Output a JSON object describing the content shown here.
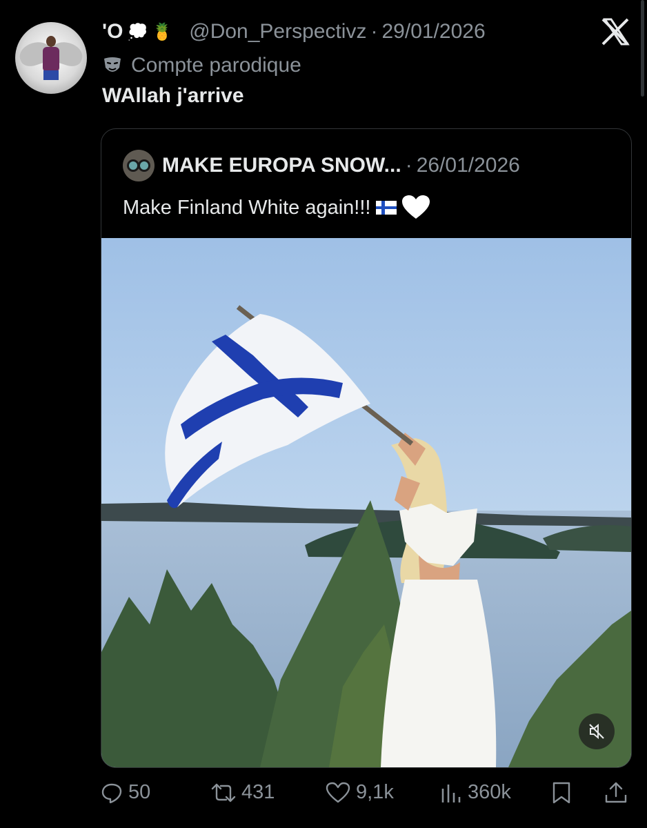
{
  "author": {
    "display_name": "'O",
    "emoji_thought": "💭",
    "emoji_pineapple": "🍍",
    "handle": "@Don_Perspectivz",
    "separator": "·",
    "date": "29/01/2026",
    "label": "Compte parodique",
    "label_icon": "theater-mask-icon"
  },
  "tweet": {
    "text": "WAllah j'arrive"
  },
  "quoted": {
    "name": "MAKE EUROPA SNOW...",
    "separator": "·",
    "date": "26/01/2026",
    "text": "Make Finland White again!!!",
    "emojis": [
      "finland-flag",
      "white-heart"
    ]
  },
  "stats": {
    "replies": "50",
    "reposts": "431",
    "likes": "9,1k",
    "views": "360k"
  },
  "colors": {
    "background": "#000000",
    "text": "#e7e9ea",
    "secondary": "#8b9299",
    "border": "#333639",
    "flag_blue": "#1f3fb0"
  }
}
